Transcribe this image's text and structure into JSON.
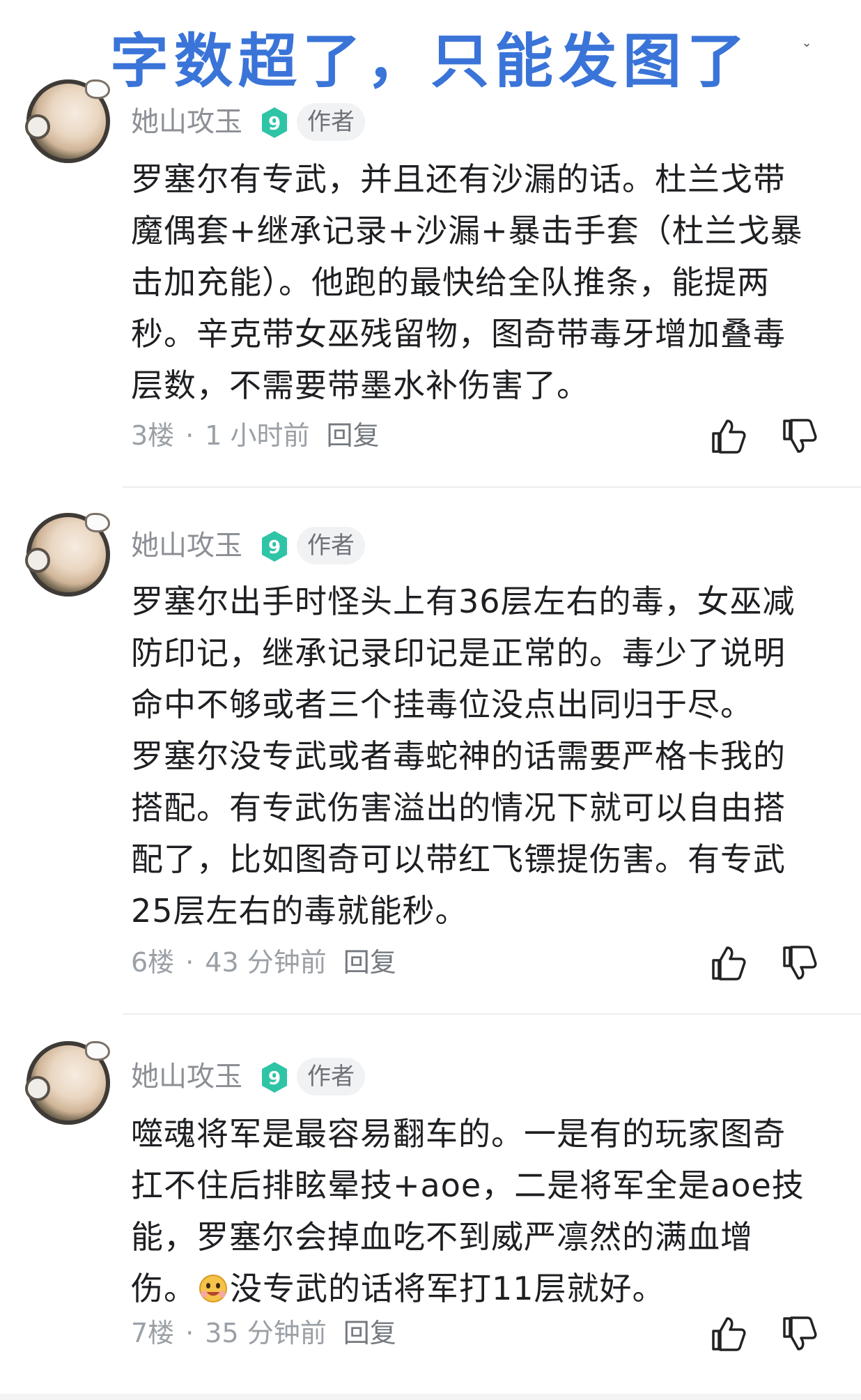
{
  "banner_text": "字数超了，只能发图了",
  "comments": [
    {
      "username": "她山攻玉",
      "level": "9",
      "author_tag": "作者",
      "paragraphs": [
        "罗塞尔有专武，并且还有沙漏的话。杜兰戈带\n魔偶套+继承记录+沙漏+暴击手套（杜兰戈暴\n击加充能）。他跑的最快给全队推条，能提两\n秒。辛克带女巫残留物，图奇带毒牙增加叠毒\n层数，不需要带墨水补伤害了。"
      ],
      "floor": "3楼",
      "time": "1 小时前",
      "reply_label": "回复"
    },
    {
      "username": "她山攻玉",
      "level": "9",
      "author_tag": "作者",
      "paragraphs": [
        "罗塞尔出手时怪头上有36层左右的毒，女巫减\n防印记，继承记录印记是正常的。毒少了说明\n命中不够或者三个挂毒位没点出同归于尽。",
        "罗塞尔没专武或者毒蛇神的话需要严格卡我的\n搭配。有专武伤害溢出的情况下就可以自由搭\n配了，比如图奇可以带红飞镖提伤害。有专武\n25层左右的毒就能秒。"
      ],
      "floor": "6楼",
      "time": "43 分钟前",
      "reply_label": "回复"
    },
    {
      "username": "她山攻玉",
      "level": "9",
      "author_tag": "作者",
      "paragraphs": [
        "噬魂将军是最容易翻车的。一是有的玩家图奇\n扛不住后排眩晕技+aoe，二是将军全是aoe技\n能，罗塞尔会掉血吃不到威严凛然的满血增\n伤。",
        "没专武的话将军打11层就好。"
      ],
      "floor": "7楼",
      "time": "35 分钟前",
      "reply_label": "回复"
    }
  ],
  "icons": {
    "like": "thumbs-up-icon",
    "dislike": "thumbs-down-icon",
    "level_badge": "level-badge-icon",
    "emoji": "grinning-emoji-icon"
  },
  "colors": {
    "banner": "#3a74d8",
    "level_badge": "#2ec4a6",
    "meta": "#9aa0a6"
  }
}
